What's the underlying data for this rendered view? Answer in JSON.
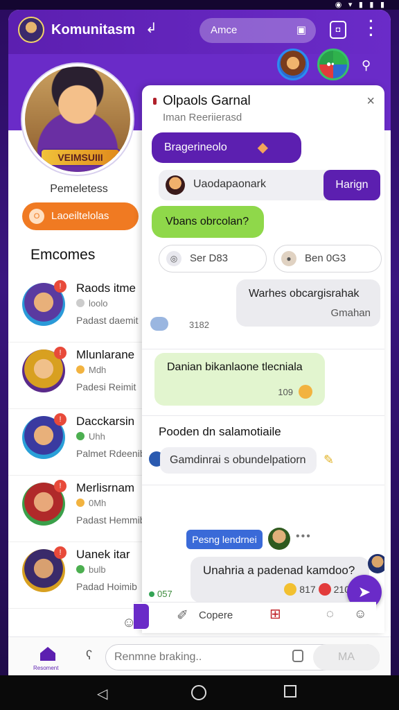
{
  "app": {
    "title": "Komunitasm",
    "search_text": "Amce",
    "lock_icon": "lock-icon",
    "bag_icon": "bag-icon",
    "menu_icon": "more-vertical-icon"
  },
  "profile": {
    "badge": "VEIMSUIII",
    "name": "Pemeletess",
    "action_button": "Laoeiltelolas",
    "action_icon_text": "O"
  },
  "contacts_section_title": "Emcomes",
  "contacts": [
    {
      "name": "Raods itme",
      "status": "loolo",
      "sub": "Padast daemit",
      "badge": "!",
      "status_color": "#cccccc"
    },
    {
      "name": "Mlunlarane",
      "status": "Mdh",
      "sub": "Padesi Reimit",
      "badge": "!",
      "status_color": "#f2b340"
    },
    {
      "name": "Dacckarsin",
      "status": "Uhh",
      "sub": "Palmet Rdeenib",
      "badge": "!",
      "status_color": "#4caf50"
    },
    {
      "name": "Merlisrnam",
      "status": "0Mh",
      "sub": "Padast Hemmib",
      "badge": "!",
      "status_color": "#f2b340"
    },
    {
      "name": "Uanek itar",
      "status": "bulb",
      "sub": "Padad Hoimib",
      "badge": "!",
      "status_color": "#4caf50"
    }
  ],
  "chat": {
    "title": "Olpaols Garnal",
    "subtitle": "Iman Reeriierasd",
    "close_label": "×",
    "m1": "Bragerineolo",
    "user_row_text": "Uaodapaonark",
    "user_row_button": "Harign",
    "m2": "Vbans obrcolan?",
    "pill1": "Ser D83",
    "pill2": "Ben 0G3",
    "m3_line1": "Warhes obcargisrahak",
    "m3_line2": "Gmahan",
    "seen_time": "3182",
    "m4": "Danian bikanlaone tlecniala",
    "m4_time": "109",
    "m5": "Pooden dn salamotiaile",
    "m6": "Gamdinrai s obundelpatiorn",
    "tag_label": "Pesng lendrnei",
    "tag_dots": "•••",
    "m7": "Unahria a padenad kamdoo?",
    "m7_meta1": "817",
    "m7_meta2": "210",
    "time_left": "057",
    "toolbar_label": "Copere"
  },
  "input": {
    "placeholder": "Renmne braking..",
    "send_label": "MA",
    "home_label": "Resoment"
  }
}
